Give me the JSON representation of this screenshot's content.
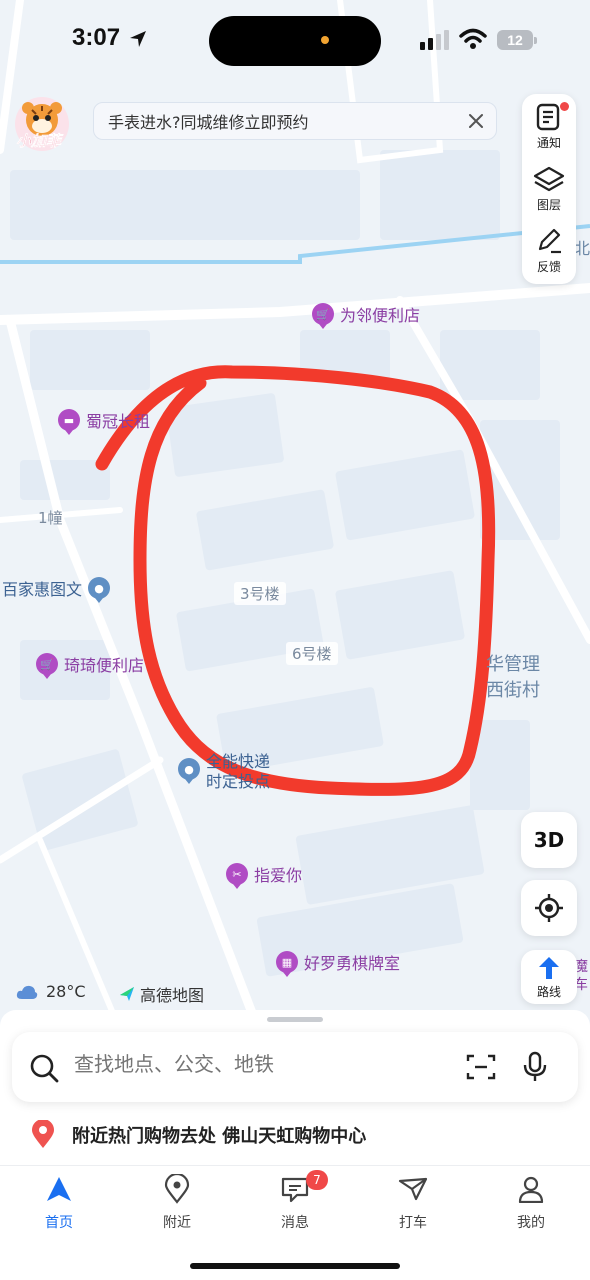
{
  "status_bar": {
    "time": "3:07",
    "battery": "12"
  },
  "avatar": {
    "label": "小加菲"
  },
  "banner": {
    "text": "手表进水?同城维修立即预约"
  },
  "tools": [
    {
      "label": "通知",
      "icon": "notice-icon"
    },
    {
      "label": "图层",
      "icon": "layers-icon"
    },
    {
      "label": "反馈",
      "icon": "feedback-icon"
    }
  ],
  "map": {
    "pois": {
      "weilin": "为邻便利店",
      "shuguan": "蜀冠长租",
      "baijiahui": "百家惠图文",
      "qiqi": "琦琦便利店",
      "quanneng": "全能快递",
      "quanneng_sub": "时定投点",
      "zhiaini": "指爱你",
      "haoluoyong": "好罗勇棋牌室",
      "mo": "魔",
      "mo_sub": "车"
    },
    "buildings": {
      "b3": "3号楼",
      "b6": "6号楼",
      "b1": "1幢"
    },
    "area": {
      "line1": "华管理",
      "line2": "西街村"
    },
    "edge": "北"
  },
  "controls": {
    "three_d": "3D",
    "route": "路线"
  },
  "weather": {
    "temp": "28°C",
    "brand": "高德地图"
  },
  "search": {
    "placeholder": "查找地点、公交、地铁"
  },
  "suggestion": {
    "text": "附近热门购物去处 佛山天虹购物中心"
  },
  "tabs": [
    {
      "label": "首页",
      "active": true
    },
    {
      "label": "附近"
    },
    {
      "label": "消息",
      "badge": "7"
    },
    {
      "label": "打车"
    },
    {
      "label": "我的"
    }
  ],
  "colors": {
    "accent": "#1a6ff0",
    "annotation": "#f23a2c",
    "poi": "#b04cc4",
    "badge": "#f04848"
  }
}
